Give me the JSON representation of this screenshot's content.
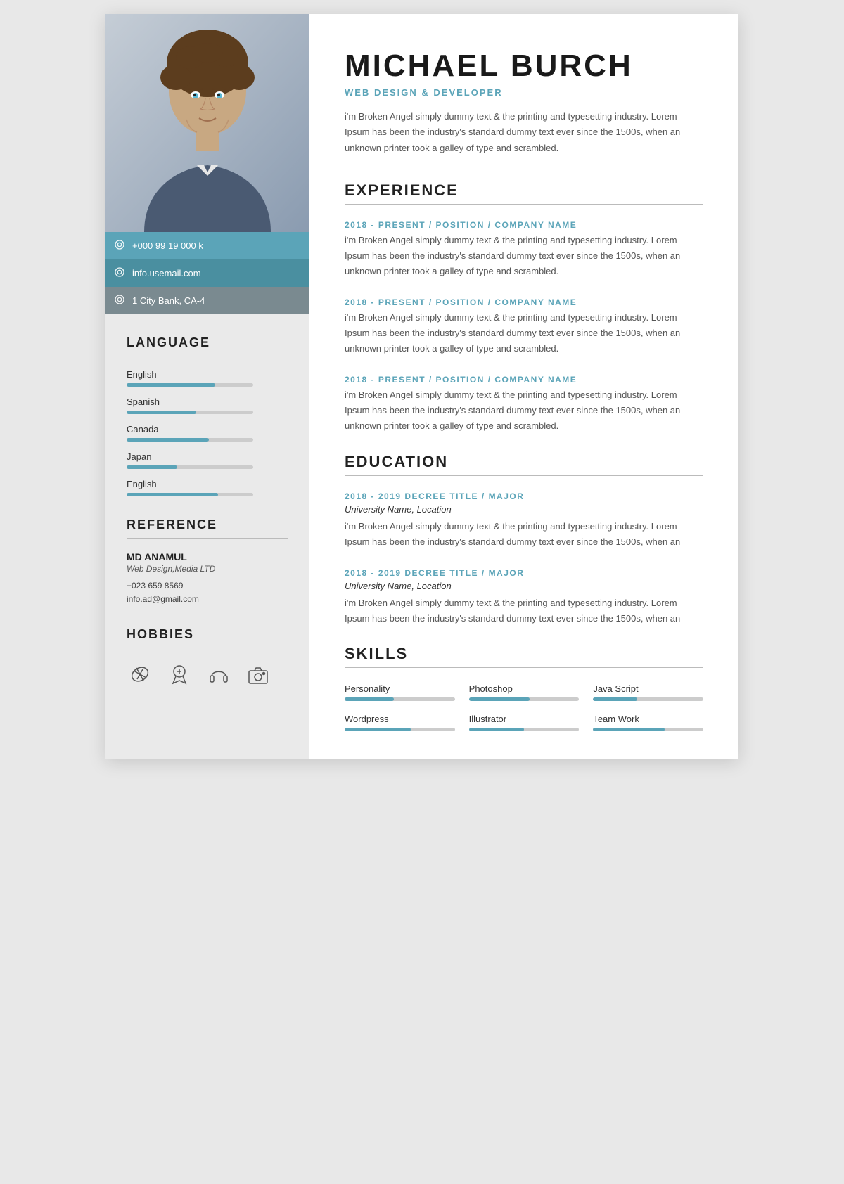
{
  "header": {
    "name": "MICHAEL BURCH",
    "title": "WEB DESIGN & DEVELOPER",
    "summary": "i'm Broken Angel simply dummy text & the printing and typesetting industry. Lorem Ipsum has been the industry's standard dummy text ever since the 1500s, when an unknown printer took a galley of type and scrambled."
  },
  "contact": {
    "phone_label": "+000 99 19 000 k",
    "email_label": "info.usemail.com",
    "address_label": "1 City Bank, CA-4"
  },
  "language_section": {
    "title": "LANGUAGE",
    "items": [
      {
        "name": "English",
        "percent": 70
      },
      {
        "name": "Spanish",
        "percent": 55
      },
      {
        "name": "Canada",
        "percent": 65
      },
      {
        "name": "Japan",
        "percent": 40
      },
      {
        "name": "English",
        "percent": 72
      }
    ]
  },
  "reference_section": {
    "title": "REFERENCE",
    "name": "MD ANAMUL",
    "job_title": "Web Design,Media LTD",
    "phone": "+023 659 8569",
    "email": "info.ad@gmail.com"
  },
  "hobbies_section": {
    "title": "HOBBIES"
  },
  "experience_section": {
    "title": "EXPERIENCE",
    "items": [
      {
        "subtitle": "2018 - PRESENT / POSITION / COMPANY NAME",
        "desc": "i'm Broken Angel simply dummy text & the printing and typesetting industry. Lorem Ipsum has been the industry's standard dummy text ever since the 1500s, when an unknown printer took a galley of type and scrambled."
      },
      {
        "subtitle": "2018 - PRESENT / POSITION / COMPANY NAME",
        "desc": "i'm Broken Angel simply dummy text & the printing and typesetting industry. Lorem Ipsum has been the industry's standard dummy text ever since the 1500s, when an unknown printer took a galley of type and scrambled."
      },
      {
        "subtitle": "2018 - PRESENT / POSITION / COMPANY NAME",
        "desc": "i'm Broken Angel simply dummy text & the printing and typesetting industry. Lorem Ipsum has been the industry's standard dummy text ever since the 1500s, when an unknown printer took a galley of type and scrambled."
      }
    ]
  },
  "education_section": {
    "title": "EDUCATION",
    "items": [
      {
        "subtitle": "2018 - 2019 DECREE TITLE / MAJOR",
        "university": "University Name, Location",
        "desc": "i'm Broken Angel simply dummy text & the printing and typesetting industry. Lorem Ipsum has been the industry's standard dummy text ever since the 1500s, when an"
      },
      {
        "subtitle": "2018 - 2019 DECREE TITLE / MAJOR",
        "university": "University Name, Location",
        "desc": "i'm Broken Angel simply dummy text & the printing and typesetting industry. Lorem Ipsum has been the industry's standard dummy text ever since the 1500s, when an"
      }
    ]
  },
  "skills_section": {
    "title": "SKILLS",
    "items": [
      {
        "name": "Personality",
        "percent": 45
      },
      {
        "name": "Photoshop",
        "percent": 55
      },
      {
        "name": "Java Script",
        "percent": 40
      },
      {
        "name": "Wordpress",
        "percent": 60
      },
      {
        "name": "Illustrator",
        "percent": 50
      },
      {
        "name": "Team Work",
        "percent": 65
      }
    ]
  }
}
